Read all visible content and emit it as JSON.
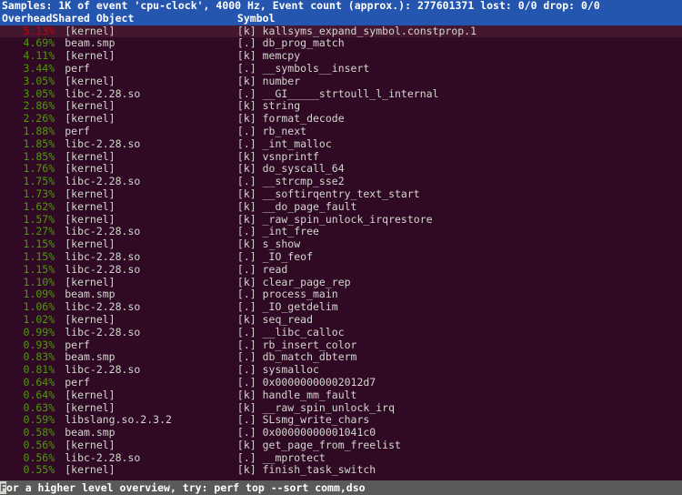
{
  "header": {
    "summary": "Samples: 1K of event 'cpu-clock', 4000 Hz, Event count (approx.): 277601371 lost: 0/0 drop: 0/0",
    "columns": {
      "overhead": "Overhead",
      "shared_object": "Shared Object",
      "symbol": "Symbol"
    }
  },
  "colors": {
    "header_bg": "#2456b0",
    "header_fg": "#ffffff",
    "terminal_bg": "#300a24",
    "selected_row_bg": "#45162f",
    "percent_fg": "#4e9a06",
    "percent_selected_fg": "#cc0000",
    "text_fg": "#d3d7cf",
    "status_bg": "#5a5a5a",
    "status_fg": "#ffffff"
  },
  "rows": [
    {
      "overhead": "5.13%",
      "dso": "[kernel]",
      "marker": "[k]",
      "symbol": "kallsyms_expand_symbol.constprop.1",
      "selected": true
    },
    {
      "overhead": "4.69%",
      "dso": "beam.smp",
      "marker": "[.]",
      "symbol": "db_prog_match",
      "selected": false
    },
    {
      "overhead": "4.11%",
      "dso": "[kernel]",
      "marker": "[k]",
      "symbol": "memcpy",
      "selected": false
    },
    {
      "overhead": "3.44%",
      "dso": "perf",
      "marker": "[.]",
      "symbol": "__symbols__insert",
      "selected": false
    },
    {
      "overhead": "3.05%",
      "dso": "[kernel]",
      "marker": "[k]",
      "symbol": "number",
      "selected": false
    },
    {
      "overhead": "3.05%",
      "dso": "libc-2.28.so",
      "marker": "[.]",
      "symbol": "__GI_____strtoull_l_internal",
      "selected": false
    },
    {
      "overhead": "2.86%",
      "dso": "[kernel]",
      "marker": "[k]",
      "symbol": "string",
      "selected": false
    },
    {
      "overhead": "2.26%",
      "dso": "[kernel]",
      "marker": "[k]",
      "symbol": "format_decode",
      "selected": false
    },
    {
      "overhead": "1.88%",
      "dso": "perf",
      "marker": "[.]",
      "symbol": "rb_next",
      "selected": false
    },
    {
      "overhead": "1.85%",
      "dso": "libc-2.28.so",
      "marker": "[.]",
      "symbol": "_int_malloc",
      "selected": false
    },
    {
      "overhead": "1.85%",
      "dso": "[kernel]",
      "marker": "[k]",
      "symbol": "vsnprintf",
      "selected": false
    },
    {
      "overhead": "1.76%",
      "dso": "[kernel]",
      "marker": "[k]",
      "symbol": "do_syscall_64",
      "selected": false
    },
    {
      "overhead": "1.75%",
      "dso": "libc-2.28.so",
      "marker": "[.]",
      "symbol": "__strcmp_sse2",
      "selected": false
    },
    {
      "overhead": "1.73%",
      "dso": "[kernel]",
      "marker": "[k]",
      "symbol": "__softirqentry_text_start",
      "selected": false
    },
    {
      "overhead": "1.62%",
      "dso": "[kernel]",
      "marker": "[k]",
      "symbol": "__do_page_fault",
      "selected": false
    },
    {
      "overhead": "1.57%",
      "dso": "[kernel]",
      "marker": "[k]",
      "symbol": "_raw_spin_unlock_irqrestore",
      "selected": false
    },
    {
      "overhead": "1.27%",
      "dso": "libc-2.28.so",
      "marker": "[.]",
      "symbol": "_int_free",
      "selected": false
    },
    {
      "overhead": "1.15%",
      "dso": "[kernel]",
      "marker": "[k]",
      "symbol": "s_show",
      "selected": false
    },
    {
      "overhead": "1.15%",
      "dso": "libc-2.28.so",
      "marker": "[.]",
      "symbol": "_IO_feof",
      "selected": false
    },
    {
      "overhead": "1.15%",
      "dso": "libc-2.28.so",
      "marker": "[.]",
      "symbol": "read",
      "selected": false
    },
    {
      "overhead": "1.10%",
      "dso": "[kernel]",
      "marker": "[k]",
      "symbol": "clear_page_rep",
      "selected": false
    },
    {
      "overhead": "1.09%",
      "dso": "beam.smp",
      "marker": "[.]",
      "symbol": "process_main",
      "selected": false
    },
    {
      "overhead": "1.06%",
      "dso": "libc-2.28.so",
      "marker": "[.]",
      "symbol": "_IO_getdelim",
      "selected": false
    },
    {
      "overhead": "1.02%",
      "dso": "[kernel]",
      "marker": "[k]",
      "symbol": "seq_read",
      "selected": false
    },
    {
      "overhead": "0.99%",
      "dso": "libc-2.28.so",
      "marker": "[.]",
      "symbol": "__libc_calloc",
      "selected": false
    },
    {
      "overhead": "0.93%",
      "dso": "perf",
      "marker": "[.]",
      "symbol": "rb_insert_color",
      "selected": false
    },
    {
      "overhead": "0.83%",
      "dso": "beam.smp",
      "marker": "[.]",
      "symbol": "db_match_dbterm",
      "selected": false
    },
    {
      "overhead": "0.81%",
      "dso": "libc-2.28.so",
      "marker": "[.]",
      "symbol": "sysmalloc",
      "selected": false
    },
    {
      "overhead": "0.64%",
      "dso": "perf",
      "marker": "[.]",
      "symbol": "0x00000000002012d7",
      "selected": false
    },
    {
      "overhead": "0.64%",
      "dso": "[kernel]",
      "marker": "[k]",
      "symbol": "handle_mm_fault",
      "selected": false
    },
    {
      "overhead": "0.63%",
      "dso": "[kernel]",
      "marker": "[k]",
      "symbol": "__raw_spin_unlock_irq",
      "selected": false
    },
    {
      "overhead": "0.59%",
      "dso": "libslang.so.2.3.2",
      "marker": "[.]",
      "symbol": "SLsmg_write_chars",
      "selected": false
    },
    {
      "overhead": "0.58%",
      "dso": "beam.smp",
      "marker": "[.]",
      "symbol": "0x00000000001041c0",
      "selected": false
    },
    {
      "overhead": "0.56%",
      "dso": "[kernel]",
      "marker": "[k]",
      "symbol": "get_page_from_freelist",
      "selected": false
    },
    {
      "overhead": "0.56%",
      "dso": "libc-2.28.so",
      "marker": "[.]",
      "symbol": "__mprotect",
      "selected": false
    },
    {
      "overhead": "0.55%",
      "dso": "[kernel]",
      "marker": "[k]",
      "symbol": "finish_task_switch",
      "selected": false
    }
  ],
  "status": {
    "cursor_char": "F",
    "text": "or a higher level overview, try: perf top --sort comm,dso"
  }
}
